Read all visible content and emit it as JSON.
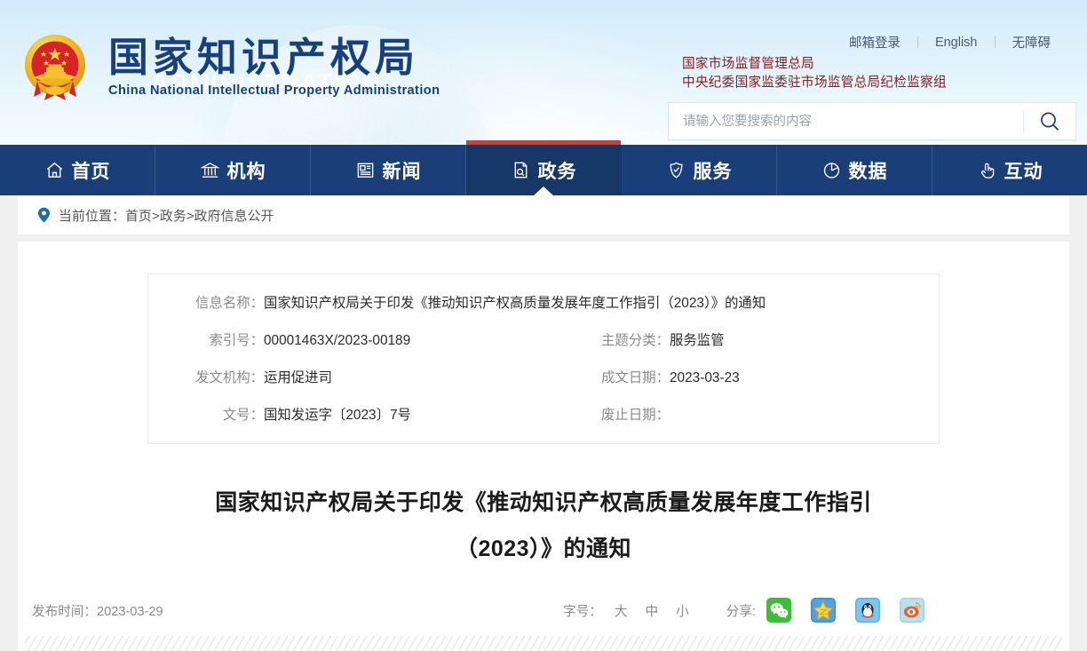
{
  "header": {
    "logo_cn": "国家知识产权局",
    "logo_en": "China National Intellectual Property Administration",
    "watermark": "ADMINISTRATION",
    "emblem_alt": "national-emblem",
    "top_links": [
      {
        "label": "邮箱登录"
      },
      {
        "label": "English"
      },
      {
        "label": "无障碍"
      }
    ],
    "agency_line1": "国家市场监督管理总局",
    "agency_line2": "中央纪委国家监委驻市场监管总局纪检监察组",
    "search": {
      "placeholder": "请输入您要搜索的内容",
      "value": "",
      "icon": "search-icon"
    }
  },
  "nav": {
    "items": [
      {
        "label": "首页",
        "icon": "home-icon",
        "active": false
      },
      {
        "label": "机构",
        "icon": "bank-icon",
        "active": false
      },
      {
        "label": "新闻",
        "icon": "newspaper-icon",
        "active": false
      },
      {
        "label": "政务",
        "icon": "document-seal-icon",
        "active": true
      },
      {
        "label": "服务",
        "icon": "shield-check-icon",
        "active": false
      },
      {
        "label": "数据",
        "icon": "pie-chart-icon",
        "active": false
      },
      {
        "label": "互动",
        "icon": "hand-click-icon",
        "active": false
      }
    ]
  },
  "breadcrumb": {
    "icon": "location-pin-icon",
    "text": "当前位置：首页>政务>政府信息公开"
  },
  "info_table": {
    "name_label": "信息名称：",
    "name_value": "国家知识产权局关于印发《推动知识产权高质量发展年度工作指引（2023）》的通知",
    "rows": [
      {
        "left_label": "索引号：",
        "left_value": "00001463X/2023-00189",
        "right_label": "主题分类：",
        "right_value": "服务监管"
      },
      {
        "left_label": "发文机构：",
        "left_value": "运用促进司",
        "right_label": "成文日期：",
        "right_value": "2023-03-23"
      },
      {
        "left_label": "文号：",
        "left_value": "国知发运字〔2023〕7号",
        "right_label": "废止日期：",
        "right_value": ""
      }
    ]
  },
  "article": {
    "title_line1": "国家知识产权局关于印发《推动知识产权高质量发展年度工作指引",
    "title_line2": "（2023）》的通知",
    "publish_label": "发布时间：",
    "publish_date": "2023-03-29"
  },
  "toolbar": {
    "fontsize_label": "字号：",
    "fontsize_options": [
      {
        "label": "大"
      },
      {
        "label": "中"
      },
      {
        "label": "小"
      }
    ],
    "share_label": "分享:",
    "share_items": [
      {
        "name": "wechat",
        "label": "微信",
        "color": "#3cbf35"
      },
      {
        "name": "qzone",
        "label": "QQ空间",
        "color": "#3f8fd6"
      },
      {
        "name": "qq",
        "label": "QQ好友",
        "color": "#59b4e8"
      },
      {
        "name": "weibo",
        "label": "新浪微博",
        "color": "#9cd4e8"
      }
    ]
  },
  "colors": {
    "nav_bg": "#1a3f78",
    "nav_active_bg": "#163868",
    "accent_red": "#b5483f",
    "brand_blue": "#16417c",
    "agency_red": "#8c1b1b"
  }
}
